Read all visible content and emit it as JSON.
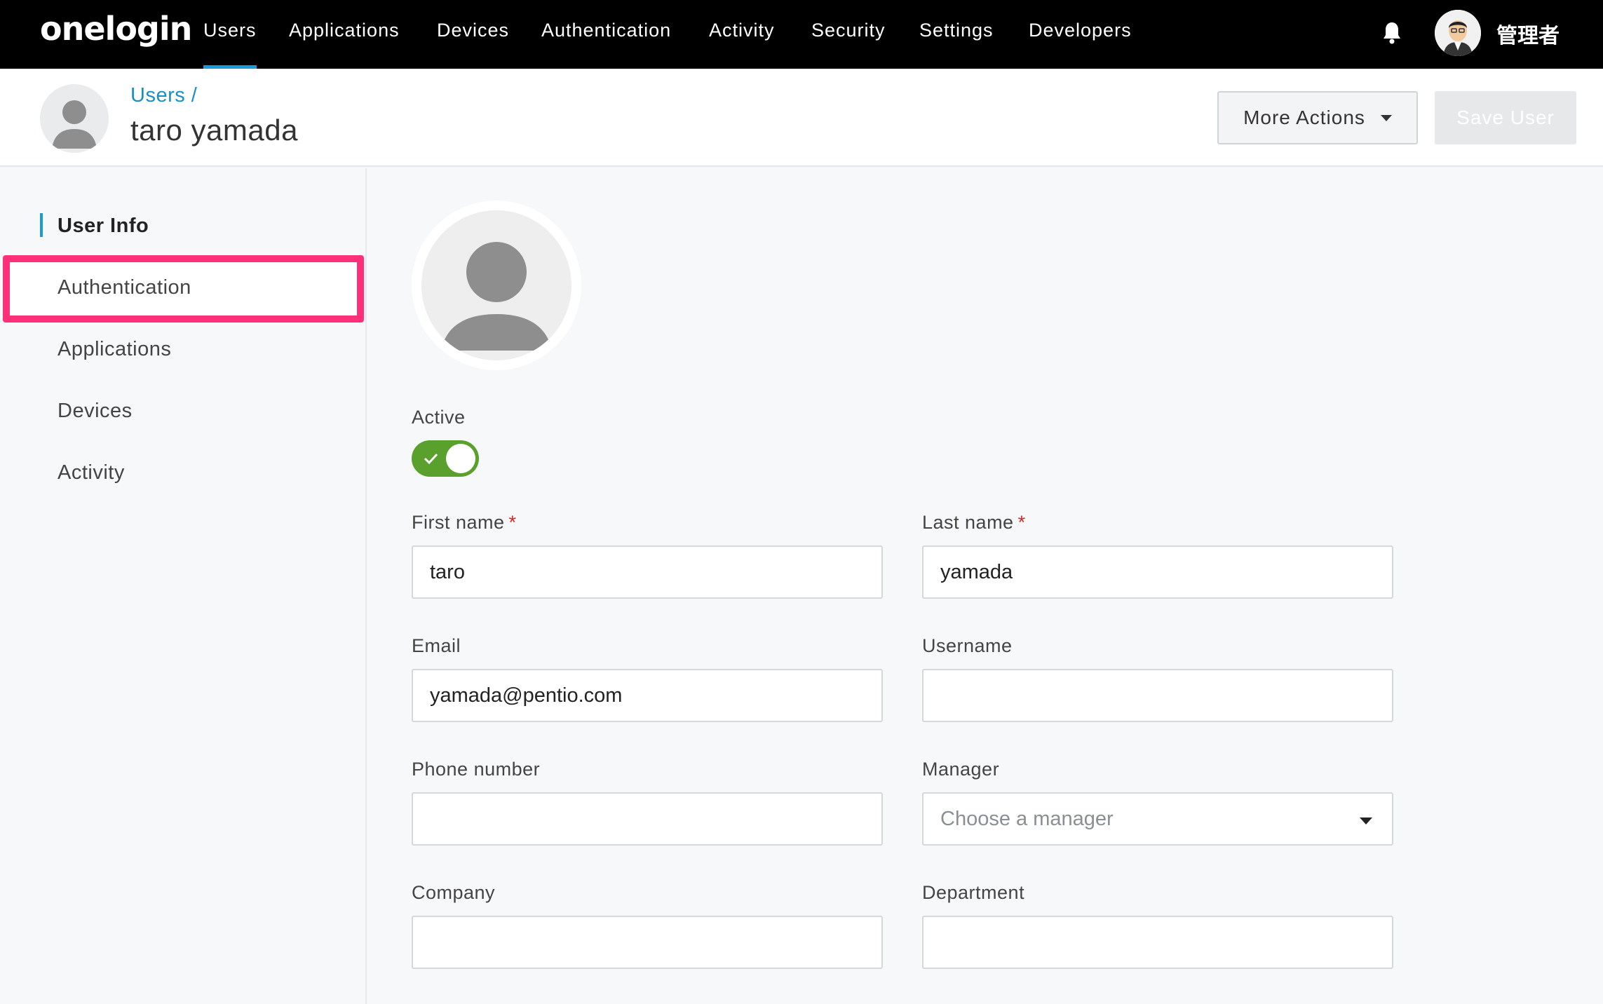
{
  "app": {
    "logo": "onelogin",
    "nav": [
      "Users",
      "Applications",
      "Devices",
      "Authentication",
      "Activity",
      "Security",
      "Settings",
      "Developers"
    ],
    "active_nav": "Users",
    "admin_name": "管理者"
  },
  "header": {
    "breadcrumb": "Users /",
    "title": "taro yamada",
    "more_actions": "More Actions",
    "save_user": "Save User"
  },
  "sidebar": {
    "items": [
      {
        "label": "User Info",
        "active": true
      },
      {
        "label": "Authentication",
        "highlighted": true
      },
      {
        "label": "Applications"
      },
      {
        "label": "Devices"
      },
      {
        "label": "Activity"
      }
    ]
  },
  "form": {
    "active_label": "Active",
    "active": true,
    "first_name_label": "First name",
    "first_name": "taro",
    "last_name_label": "Last name",
    "last_name": "yamada",
    "required_mark": "*",
    "email_label": "Email",
    "email": "yamada@pentio.com",
    "username_label": "Username",
    "username": "",
    "phone_label": "Phone number",
    "phone": "",
    "manager_label": "Manager",
    "manager_placeholder": "Choose a manager",
    "company_label": "Company",
    "company": "",
    "department_label": "Department",
    "department": ""
  },
  "colors": {
    "accent": "#1a9ad6",
    "toggle_on": "#5aa02c",
    "highlight": "#ff2f7a",
    "required": "#e0202a"
  }
}
